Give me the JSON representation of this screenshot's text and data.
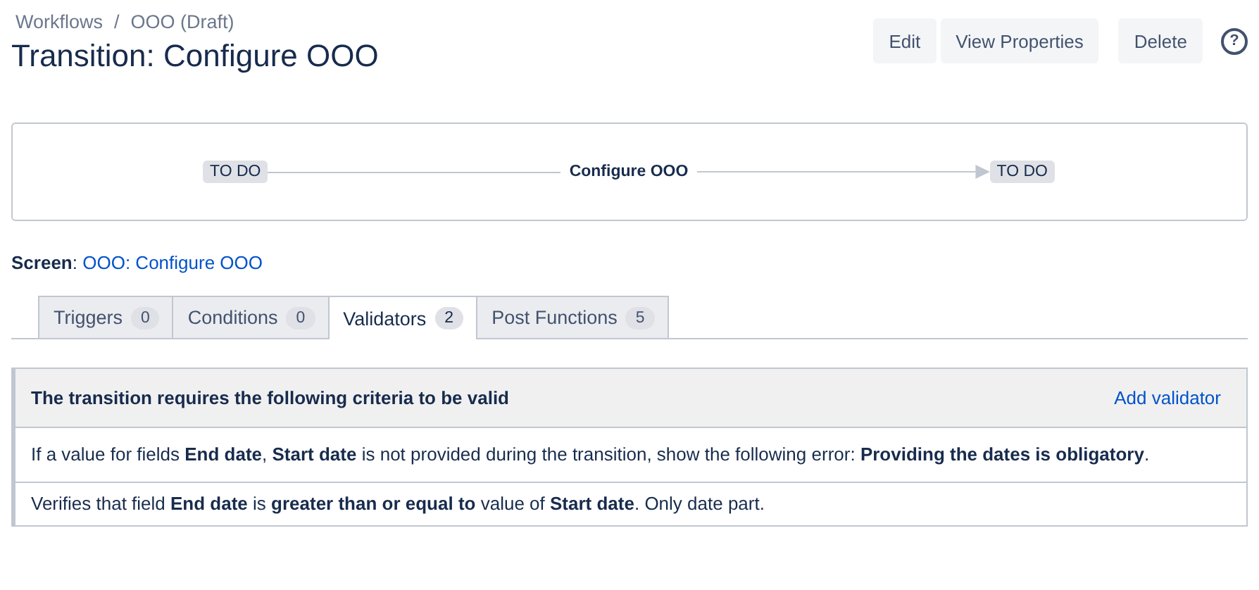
{
  "breadcrumbs": [
    {
      "label": "Workflows"
    },
    {
      "label": "OOO (Draft)"
    }
  ],
  "breadcrumb_separator": "/",
  "title": "Transition: Configure OOO",
  "actions": [
    {
      "label": "Edit"
    },
    {
      "label": "View Properties"
    },
    {
      "label": "Delete"
    }
  ],
  "help_icon": "?",
  "diagram": {
    "from": "TO DO",
    "transition": "Configure OOO",
    "to": "TO DO"
  },
  "screen": {
    "label": "**Screen**:",
    "value": "OOO: Configure OOO"
  },
  "tabs": [
    {
      "label": "Triggers",
      "count": "0",
      "selected": false
    },
    {
      "label": "Conditions",
      "count": "0",
      "selected": false
    },
    {
      "label": "Validators",
      "count": "2",
      "selected": true
    },
    {
      "label": "Post Functions",
      "count": "5",
      "selected": false
    }
  ],
  "panel": {
    "heading": "The transition requires the following criteria to be valid",
    "action": "Add validator",
    "rows": [
      "If a value for fields **End date**, **Start date** is not provided during the transition, show the following error: **Providing the dates is obligatory**.",
      "Verifies that field **End date** is **greater than or equal to** value of **Start date**. Only date part."
    ]
  }
}
